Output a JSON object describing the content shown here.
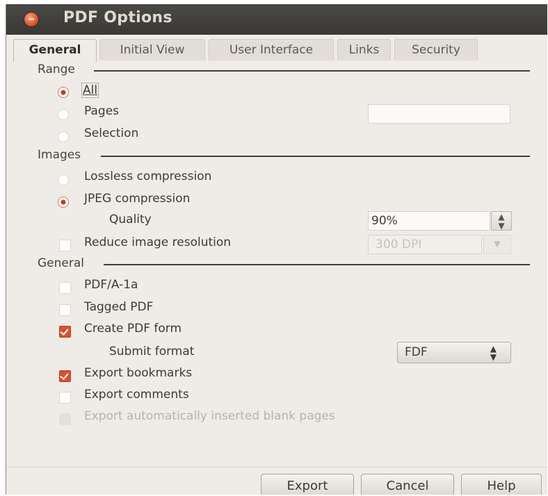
{
  "window": {
    "title": "PDF Options"
  },
  "tabs": [
    {
      "label": "General",
      "active": true
    },
    {
      "label": "Initial View",
      "active": false
    },
    {
      "label": "User Interface",
      "active": false
    },
    {
      "label": "Links",
      "active": false
    },
    {
      "label": "Security",
      "active": false
    }
  ],
  "range": {
    "label": "Range",
    "all": {
      "label": "All",
      "selected": true
    },
    "pages": {
      "label": "Pages",
      "selected": false,
      "value": ""
    },
    "selection": {
      "label": "Selection",
      "selected": false
    }
  },
  "images": {
    "label": "Images",
    "lossless": {
      "label": "Lossless compression",
      "selected": false
    },
    "jpeg": {
      "label": "JPEG compression",
      "selected": true
    },
    "quality_label": "Quality",
    "quality_value": "90%",
    "reduce": {
      "label": "Reduce image resolution",
      "checked": false
    },
    "resolution_value": "300 DPI"
  },
  "general": {
    "label": "General",
    "pdfa": {
      "label": "PDF/A-1a",
      "checked": false
    },
    "tagged": {
      "label": "Tagged PDF",
      "checked": false
    },
    "create_form": {
      "label": "Create PDF form",
      "checked": true
    },
    "submit_format_label": "Submit format",
    "submit_format_value": "FDF",
    "export_bookmarks": {
      "label": "Export bookmarks",
      "checked": true
    },
    "export_comments": {
      "label": "Export comments",
      "checked": false
    },
    "export_blank": {
      "label": "Export automatically inserted blank pages",
      "checked": false,
      "disabled": true
    }
  },
  "buttons": {
    "export": "Export",
    "cancel": "Cancel",
    "help": "Help"
  },
  "colors": {
    "accent": "#d9502f",
    "titlebar": "#3c3b37",
    "window_bg": "#efebe7"
  }
}
